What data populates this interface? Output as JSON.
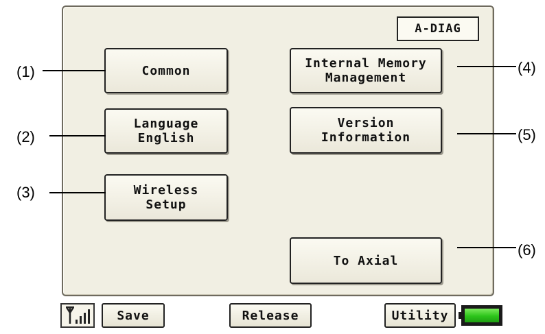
{
  "mode_label": "A-DIAG",
  "buttons": {
    "common": [
      "Common"
    ],
    "language": [
      "Language",
      "English"
    ],
    "wireless": [
      "Wireless",
      "Setup"
    ],
    "internal_memory": [
      "Internal Memory",
      "Management"
    ],
    "version": [
      "Version",
      "Information"
    ],
    "to_axial": [
      "To Axial"
    ]
  },
  "callouts": [
    "(1)",
    "(2)",
    "(3)",
    "(4)",
    "(5)",
    "(6)"
  ],
  "bottom_bar": {
    "signal_icon": "signal-strength-icon",
    "save": "Save",
    "release": "Release",
    "utility": "Utility",
    "battery_icon": "battery-icon",
    "battery_level": 1.0
  },
  "colors": {
    "screen_bg": "#f1efe3",
    "battery_fill": "#2cc41a"
  }
}
